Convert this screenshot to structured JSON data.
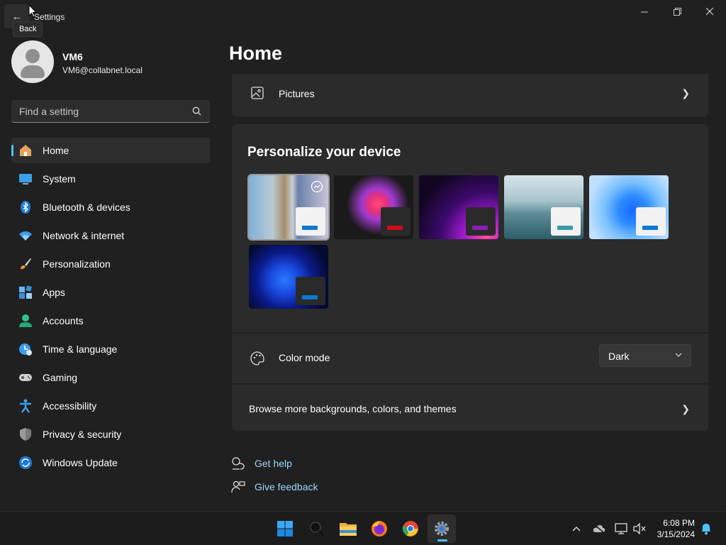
{
  "window": {
    "title": "Settings",
    "back_tooltip": "Back"
  },
  "profile": {
    "name": "VM6",
    "email": "VM6@collabnet.local"
  },
  "search": {
    "placeholder": "Find a setting"
  },
  "sidebar": {
    "items": [
      {
        "label": "Home",
        "icon": "home-icon",
        "active": true
      },
      {
        "label": "System",
        "icon": "system-icon"
      },
      {
        "label": "Bluetooth & devices",
        "icon": "bluetooth-icon"
      },
      {
        "label": "Network & internet",
        "icon": "network-icon"
      },
      {
        "label": "Personalization",
        "icon": "brush-icon"
      },
      {
        "label": "Apps",
        "icon": "apps-icon"
      },
      {
        "label": "Accounts",
        "icon": "accounts-icon"
      },
      {
        "label": "Time & language",
        "icon": "clock-icon"
      },
      {
        "label": "Gaming",
        "icon": "gamepad-icon"
      },
      {
        "label": "Accessibility",
        "icon": "accessibility-icon"
      },
      {
        "label": "Privacy & security",
        "icon": "shield-icon"
      },
      {
        "label": "Windows Update",
        "icon": "update-icon"
      }
    ]
  },
  "main": {
    "title": "Home",
    "pictures_label": "Pictures",
    "personalize_title": "Personalize your device",
    "themes": [
      {
        "name": "photos-theme",
        "accent": "#0a78d4",
        "selected": true
      },
      {
        "name": "glow-theme",
        "accent": "#d10a1a"
      },
      {
        "name": "captured-motion-theme",
        "accent": "#8a1fb8"
      },
      {
        "name": "flow-theme",
        "accent": "#3a9aa8"
      },
      {
        "name": "windows-light-theme",
        "accent": "#0a78d4"
      },
      {
        "name": "windows-dark-theme",
        "accent": "#0a78d4"
      }
    ],
    "color_mode_label": "Color mode",
    "color_mode_value": "Dark",
    "browse_label": "Browse more backgrounds, colors, and themes",
    "get_help": "Get help",
    "give_feedback": "Give feedback"
  },
  "taskbar": {
    "apps": [
      "start-icon",
      "search-icon",
      "file-explorer-icon",
      "firefox-icon",
      "chrome-icon",
      "settings-icon"
    ],
    "time": "6:08 PM",
    "date": "3/15/2024"
  },
  "colors": {
    "accent": "#4cc2ff",
    "background": "#202020",
    "card": "#2b2b2b",
    "link": "#9ad6ff"
  }
}
